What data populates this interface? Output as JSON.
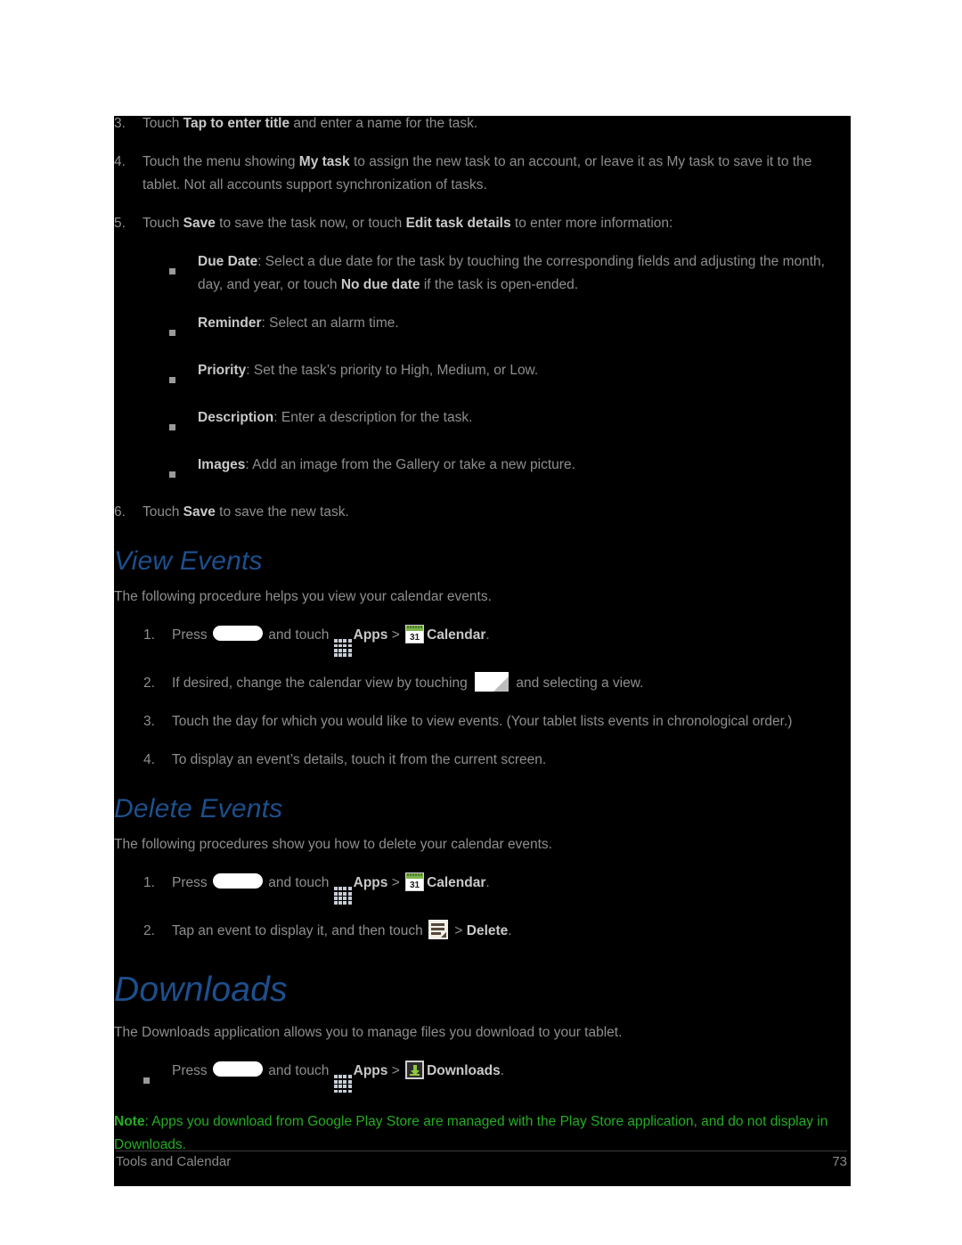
{
  "colors": {
    "page_background": "#000000",
    "body_text": "#8e8e8e",
    "bold_text": "#c9c9c9",
    "heading_blue": "#1d4f8c",
    "note_green": "#25ac25",
    "calendar_green": "#7ab648",
    "download_arrow_green": "#8ec63f"
  },
  "task_steps": {
    "step3": {
      "marker": "3.",
      "p1": "Touch ",
      "b1": "Tap to enter title",
      "p2": " and enter a name for the task."
    },
    "step4": {
      "marker": "4.",
      "p1": "Touch the menu showing ",
      "b1": "My task",
      "p2": " to assign the new task to an account, or leave it as My task to save it to the tablet. Not all accounts support synchronization of tasks."
    },
    "step5": {
      "marker": "5.",
      "p1": "Touch ",
      "b1": "Save",
      "p2": " to save the task now, or touch ",
      "b2": "Edit task details",
      "p3": " to enter more information:"
    },
    "substeps": [
      {
        "label": "Due Date",
        "p1": ": Select a due date for the task by touching the corresponding fields and adjusting the month, day, and year, or touch ",
        "b2": "No due date",
        "p2": " if the task is open-ended."
      },
      {
        "label": "Reminder",
        "p1": ": Select an alarm time.",
        "b2": "",
        "p2": ""
      },
      {
        "label": "Priority",
        "p1": ": Set the task’s priority to High, Medium, or Low.",
        "b2": "",
        "p2": ""
      },
      {
        "label": "Description",
        "p1": ": Enter a description for the task.",
        "b2": "",
        "p2": ""
      },
      {
        "label": "Images",
        "p1": ": Add an image from the Gallery or take a new picture.",
        "b2": "",
        "p2": ""
      }
    ],
    "step6": {
      "marker": "6.",
      "p1": "Touch ",
      "b1": "Save",
      "p2": " to save the new task."
    }
  },
  "view_events": {
    "heading": "View Events",
    "intro": "The following procedure helps you view your calendar events.",
    "step1": {
      "marker": "1.",
      "press": "Press ",
      "and_touch": " and touch ",
      "apps": "Apps",
      "gt": " > ",
      "calendar": "Calendar",
      "period": ".",
      "calendar_day": "31",
      "home_icon": "home-key-icon",
      "apps_icon": "apps-grid-icon",
      "calendar_icon": "calendar-icon"
    },
    "step2": {
      "marker": "2.",
      "p1": "If desired, change the calendar view by touching ",
      "p2": " and selecting a view.",
      "view_icon": "calendar-view-selector-icon"
    },
    "step3": {
      "marker": "3.",
      "p1": "Touch the day for which you would like to view events. (Your tablet lists events in chronological order.)"
    },
    "step4": {
      "marker": "4.",
      "p1": "To display an event’s details, touch it from the current screen."
    }
  },
  "delete_events": {
    "heading": "Delete Events",
    "intro": "The following procedures show you how to delete your calendar events.",
    "step1": {
      "marker": "1.",
      "press": "Press ",
      "and_touch": " and touch ",
      "apps": "Apps",
      "gt": " > ",
      "calendar": "Calendar",
      "period": ".",
      "calendar_day": "31"
    },
    "step2": {
      "marker": "2.",
      "p1": "Tap an event to display it, and then touch ",
      "gt": " > ",
      "b1": "Delete",
      "period": ".",
      "menu_icon": "menu-list-icon"
    }
  },
  "downloads": {
    "heading": "Downloads",
    "intro": "The Downloads application allows you to manage files you download to your tablet.",
    "bullet": {
      "press": "Press ",
      "and_touch": " and touch ",
      "apps": "Apps",
      "gt": " > ",
      "downloads": "Downloads",
      "period": ".",
      "downloads_icon": "downloads-arrow-icon"
    },
    "note": {
      "label": "Note",
      "text": ": Apps you download from Google Play Store are managed with the Play Store application, and do not display in Downloads."
    }
  },
  "footer": {
    "chapter": "Tools and Calendar",
    "page_number": "73"
  }
}
